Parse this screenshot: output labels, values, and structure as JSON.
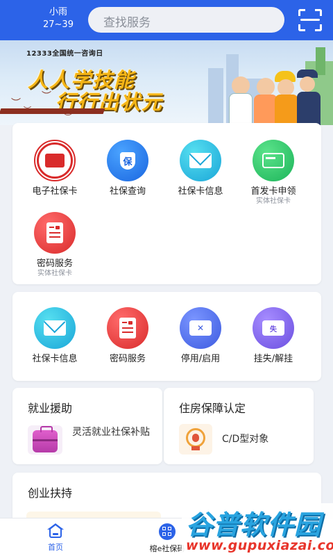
{
  "header": {
    "weather_condition": "小雨",
    "weather_temp": "27~39",
    "search_placeholder": "查找服务",
    "scan_icon": "scan-icon"
  },
  "banner": {
    "tag": "12333全国统一咨询日",
    "line1": "人人学技能",
    "line2": "行行出状元"
  },
  "services_card1": [
    {
      "label": "电子社保卡",
      "sub": "",
      "icon": "social-security-card-icon",
      "color": "#d92b2b"
    },
    {
      "label": "社保查询",
      "sub": "",
      "icon": "shield-bao-icon",
      "color": "#1a66e0"
    },
    {
      "label": "社保卡信息",
      "sub": "",
      "icon": "envelope-icon",
      "color": "#1aa6d8"
    },
    {
      "label": "首发卡申领",
      "sub": "实体社保卡",
      "icon": "card-icon",
      "color": "#1cb45a"
    },
    {
      "label": "密码服务",
      "sub": "实体社保卡",
      "icon": "lock-document-icon",
      "color": "#d92b2b"
    }
  ],
  "services_card2": [
    {
      "label": "社保卡信息",
      "icon": "envelope-icon",
      "color": "#1aa6d8"
    },
    {
      "label": "密码服务",
      "icon": "lock-document-icon",
      "color": "#d92b2b"
    },
    {
      "label": "停用/启用",
      "icon": "card-disable-icon",
      "color": "#3d5be0"
    },
    {
      "label": "挂失/解挂",
      "icon": "card-lost-icon",
      "color": "#6b4fe0"
    }
  ],
  "features": {
    "employment_title": "就业援助",
    "employment_item": "灵活就业社保补贴",
    "housing_title": "住房保障认定",
    "housing_item": "C/D型对象",
    "entrepreneurship_title": "创业扶持"
  },
  "tabbar": {
    "home": "首页",
    "social_code": "榕e社保码"
  },
  "watermark": {
    "name": "谷普软件园",
    "url": "www.gupuxiazai.com"
  },
  "colors": {
    "primary": "#2c63e8",
    "accent_gold": "#f5b516",
    "watermark_blue": "#29a4e0",
    "watermark_red": "#e8352b"
  }
}
